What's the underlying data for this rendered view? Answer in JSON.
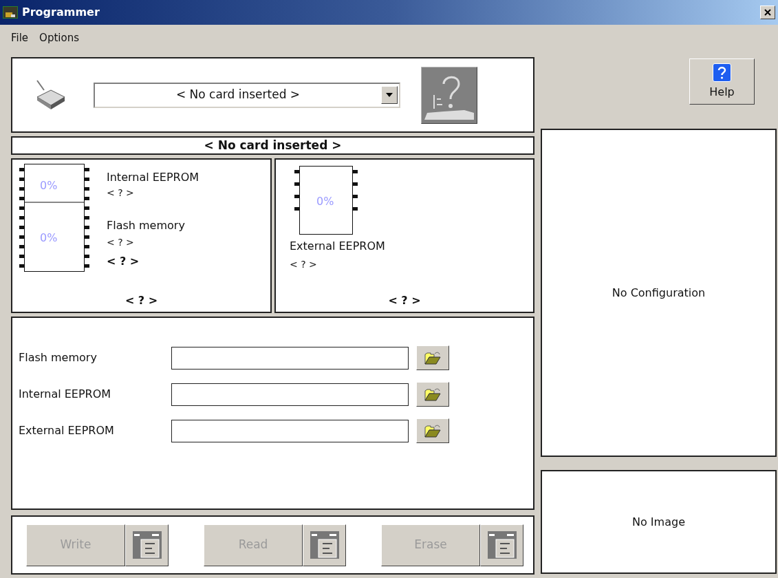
{
  "window": {
    "title": "Programmer"
  },
  "menu": [
    "File",
    "Options"
  ],
  "card_select": {
    "value": "< No card inserted >"
  },
  "card_status": "< No card inserted >",
  "memory_panels": [
    {
      "kind": "dual",
      "upper": {
        "percent": "0%",
        "name": "Internal EEPROM",
        "detail": "< ? >"
      },
      "lower": {
        "percent": "0%",
        "name": "Flash memory",
        "detail": "< ? >"
      },
      "size": "< ? >",
      "footer": "< ? >"
    },
    {
      "kind": "single",
      "chip": {
        "percent": "0%",
        "name": "External EEPROM",
        "detail": "< ? >"
      },
      "footer": "< ? >"
    }
  ],
  "files": [
    {
      "label": "Flash memory"
    },
    {
      "label": "Internal EEPROM"
    },
    {
      "label": "External EEPROM"
    }
  ],
  "actions": [
    {
      "label": "Write",
      "disabled": true
    },
    {
      "label": "Read",
      "disabled": true
    },
    {
      "label": "Erase",
      "disabled": true
    }
  ],
  "help": {
    "label": "Help"
  },
  "configuration": "No Configuration",
  "image": "No Image"
}
